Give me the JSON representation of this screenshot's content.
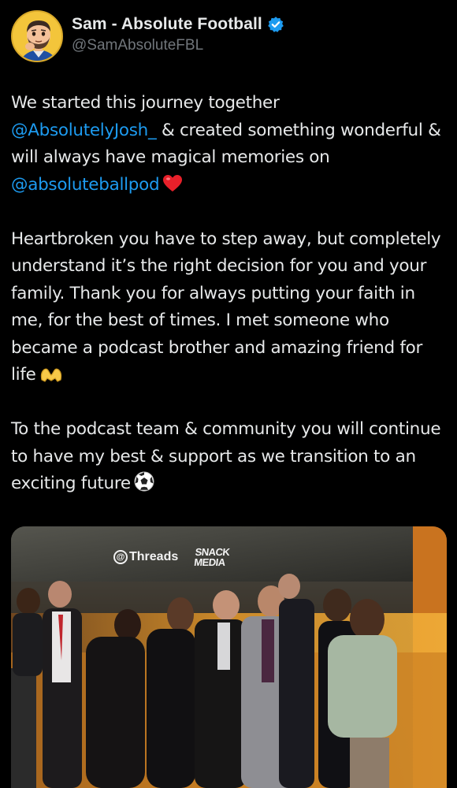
{
  "author": {
    "display_name": "Sam - Absolute Football",
    "handle": "@SamAbsoluteFBL",
    "verified": true,
    "avatar_icon": "cartoon-avatar-icon"
  },
  "tweet": {
    "p1": {
      "t1": "We started this journey together",
      "mention1": "@AbsolutelyJosh_",
      "t2": " & created something wonderful & will always have magical memories on ",
      "mention2": "@absoluteballpod",
      "emoji": "heart-icon"
    },
    "p2": {
      "text": "Heartbroken you have to step away, but completely understand it’s the right decision for you and your family. Thank you for always putting your faith in me, for the best of times. I met someone who became a podcast brother and amazing friend for life",
      "emoji": "heart-hands-icon"
    },
    "p3": {
      "text": "To the podcast team & community you will continue to have my best & support as we transition to an exciting future",
      "emoji": "soccer-ball-icon"
    }
  },
  "media": {
    "sign_threads": "Threads",
    "sign_snack_1": "SNACK",
    "sign_snack_2": "MEDIA"
  },
  "colors": {
    "background": "#000000",
    "text": "#e7e9ea",
    "secondary": "#71767b",
    "link": "#1d9bf0",
    "verified": "#1d9bf0"
  }
}
